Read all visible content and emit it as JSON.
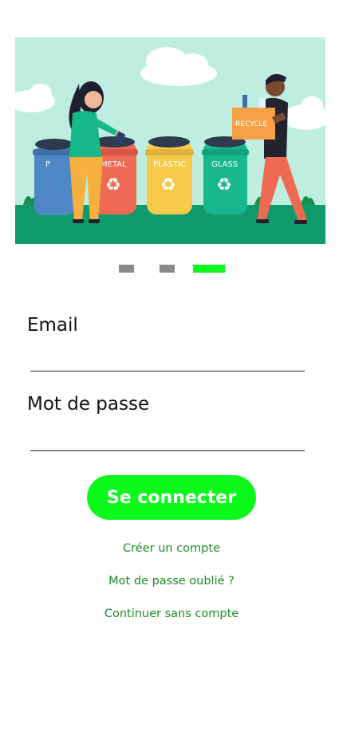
{
  "hero": {
    "bins": [
      {
        "label": "P",
        "color": "#4f86c6"
      },
      {
        "label": "METAL",
        "color": "#ef6a52"
      },
      {
        "label": "PLASTIC",
        "color": "#f7c94b"
      },
      {
        "label": "GLASS",
        "color": "#18b88f"
      }
    ],
    "box_label": "RECYCLE",
    "colors": {
      "sky": "#bfeee0",
      "ground": "#0f9a6b",
      "cloud": "#ffffff"
    }
  },
  "carousel": {
    "total": 3,
    "active_index": 3,
    "active_color": "#0bf91d",
    "inactive_color": "#8a8a8a"
  },
  "form": {
    "email_label": "Email",
    "email_value": "",
    "password_label": "Mot de passe",
    "password_value": "",
    "submit_label": "Se connecter"
  },
  "links": {
    "create_account": "Créer un compte",
    "forgot_password": "Mot de passe oublié ?",
    "continue_guest": "Continuer sans compte"
  },
  "theme": {
    "accent": "#0bf91d",
    "link": "#1f8b24"
  }
}
